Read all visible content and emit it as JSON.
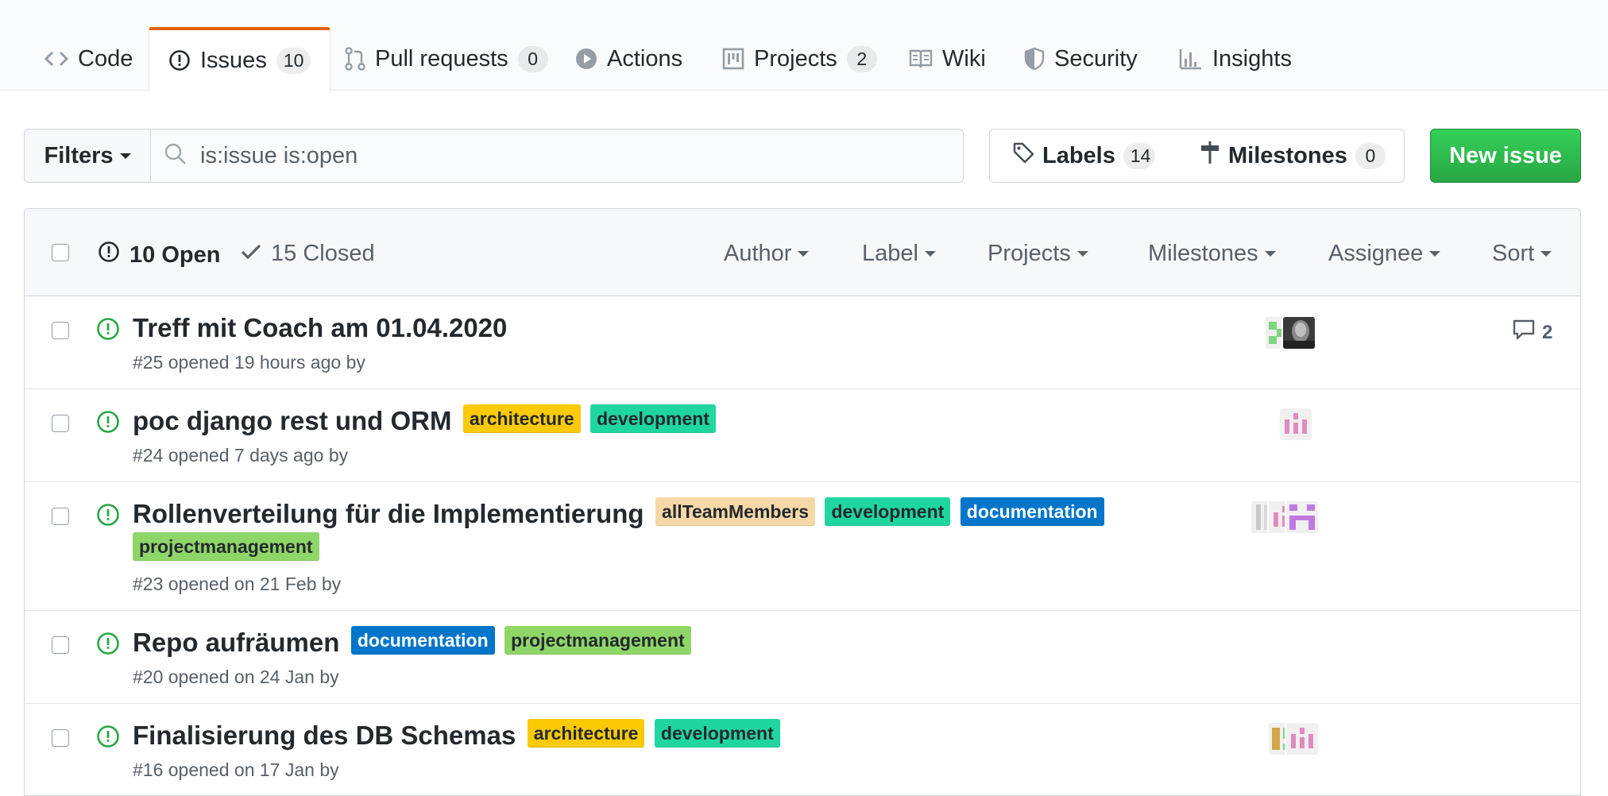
{
  "tabs": [
    {
      "label": "Code",
      "icon": "code-icon",
      "count": null
    },
    {
      "label": "Issues",
      "icon": "issue-opened-icon",
      "count": "10",
      "selected": true
    },
    {
      "label": "Pull requests",
      "icon": "git-pull-request-icon",
      "count": "0"
    },
    {
      "label": "Actions",
      "icon": "play-icon",
      "count": null
    },
    {
      "label": "Projects",
      "icon": "project-icon",
      "count": "2"
    },
    {
      "label": "Wiki",
      "icon": "book-icon",
      "count": null
    },
    {
      "label": "Security",
      "icon": "shield-icon",
      "count": null
    },
    {
      "label": "Insights",
      "icon": "graph-icon",
      "count": null
    }
  ],
  "toolbar": {
    "filters_label": "Filters",
    "search_value": "is:issue is:open",
    "labels_label": "Labels",
    "labels_count": "14",
    "milestones_label": "Milestones",
    "milestones_count": "0",
    "new_issue_label": "New issue"
  },
  "header": {
    "open_label": "10 Open",
    "closed_label": "15 Closed",
    "menus": [
      "Author",
      "Label",
      "Projects",
      "Milestones",
      "Assignee",
      "Sort"
    ]
  },
  "issues": [
    {
      "title": "Treff mit Coach am 01.04.2020",
      "labels": [],
      "meta": "#25 opened 19 hours ago by",
      "comments": "2"
    },
    {
      "title": "poc django rest und ORM",
      "labels": [
        {
          "name": "architecture",
          "bg": "#fbca04",
          "fg": "#24292e"
        },
        {
          "name": "development",
          "bg": "#1fd6a0",
          "fg": "#24292e"
        }
      ],
      "meta": "#24 opened 7 days ago by",
      "comments": null
    },
    {
      "title": "Rollenverteilung für die Implementierung",
      "labels": [
        {
          "name": "allTeamMembers",
          "bg": "#f6d8a8",
          "fg": "#24292e"
        },
        {
          "name": "development",
          "bg": "#1fd6a0",
          "fg": "#24292e"
        },
        {
          "name": "documentation",
          "bg": "#0075ca",
          "fg": "#ffffff"
        },
        {
          "name": "projectmanagement",
          "bg": "#8fd669",
          "fg": "#24292e"
        }
      ],
      "meta": "#23 opened on 21 Feb by",
      "comments": null
    },
    {
      "title": "Repo aufräumen",
      "labels": [
        {
          "name": "documentation",
          "bg": "#0075ca",
          "fg": "#ffffff"
        },
        {
          "name": "projectmanagement",
          "bg": "#8fd669",
          "fg": "#24292e"
        }
      ],
      "meta": "#20 opened on 24 Jan by",
      "comments": null
    },
    {
      "title": "Finalisierung des DB Schemas",
      "labels": [
        {
          "name": "architecture",
          "bg": "#fbca04",
          "fg": "#24292e"
        },
        {
          "name": "development",
          "bg": "#1fd6a0",
          "fg": "#24292e"
        }
      ],
      "meta": "#16 opened on 17 Jan by",
      "comments": null
    }
  ],
  "colors": {
    "accent_tab": "#e36209",
    "open_green": "#28a745",
    "new_issue_bg": "#2ea44f"
  }
}
